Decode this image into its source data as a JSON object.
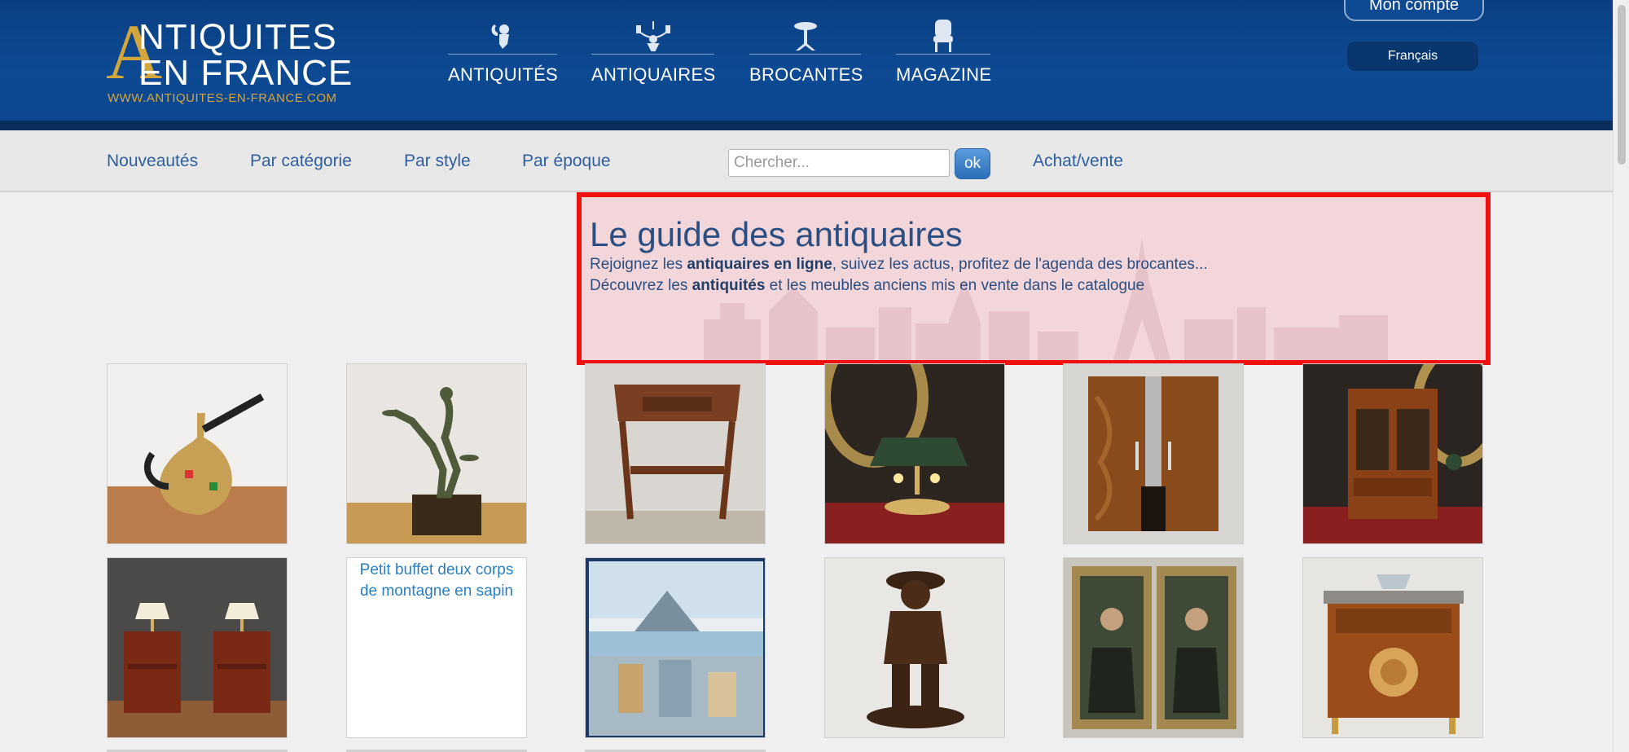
{
  "logo": {
    "letter": "A",
    "line1": "NTIQUITES",
    "line2": "EN FRANCE",
    "url": "WWW.ANTIQUITES-EN-FRANCE.COM"
  },
  "main_nav": [
    {
      "label": "ANTIQUITÉS",
      "icon": "cherub-icon"
    },
    {
      "label": "ANTIQUAIRES",
      "icon": "chandelier-icon"
    },
    {
      "label": "BROCANTES",
      "icon": "pedestal-table-icon"
    },
    {
      "label": "MAGAZINE",
      "icon": "armchair-icon"
    }
  ],
  "account": {
    "label": "Mon compte"
  },
  "language": {
    "label": "Français"
  },
  "sub_nav": {
    "nouveautes": "Nouveautés",
    "categorie": "Par catégorie",
    "style": "Par style",
    "epoque": "Par époque",
    "achat": "Achat/vente"
  },
  "search": {
    "placeholder": "Chercher...",
    "value": "",
    "button": "ok"
  },
  "guide": {
    "title": "Le guide des antiquaires",
    "line1_pre": "Rejoignez les ",
    "line1_bold": "antiquaires en ligne",
    "line1_post": ", suivez les actus, profitez de l'agenda des brocantes...",
    "line2_pre": "Découvrez les ",
    "line2_bold": "antiquités",
    "line2_post": " et les meubles anciens mis en vente dans le catalogue"
  },
  "products": [
    {
      "name": "ceramic-pitcher-image"
    },
    {
      "name": "bronze-dancer-statue-image"
    },
    {
      "name": "side-table-image"
    },
    {
      "name": "bouillotte-lamp-image"
    },
    {
      "name": "art-deco-cabinet-image"
    },
    {
      "name": "vitrine-cabinet-image"
    },
    {
      "name": "pair-nightstands-image"
    },
    {
      "name": "broken-image",
      "alt": "Petit buffet deux corps de montagne en sapin"
    },
    {
      "name": "watercolor-city-image"
    },
    {
      "name": "bronze-figure-image"
    },
    {
      "name": "pair-portraits-image"
    },
    {
      "name": "marquetry-commode-image"
    }
  ]
}
